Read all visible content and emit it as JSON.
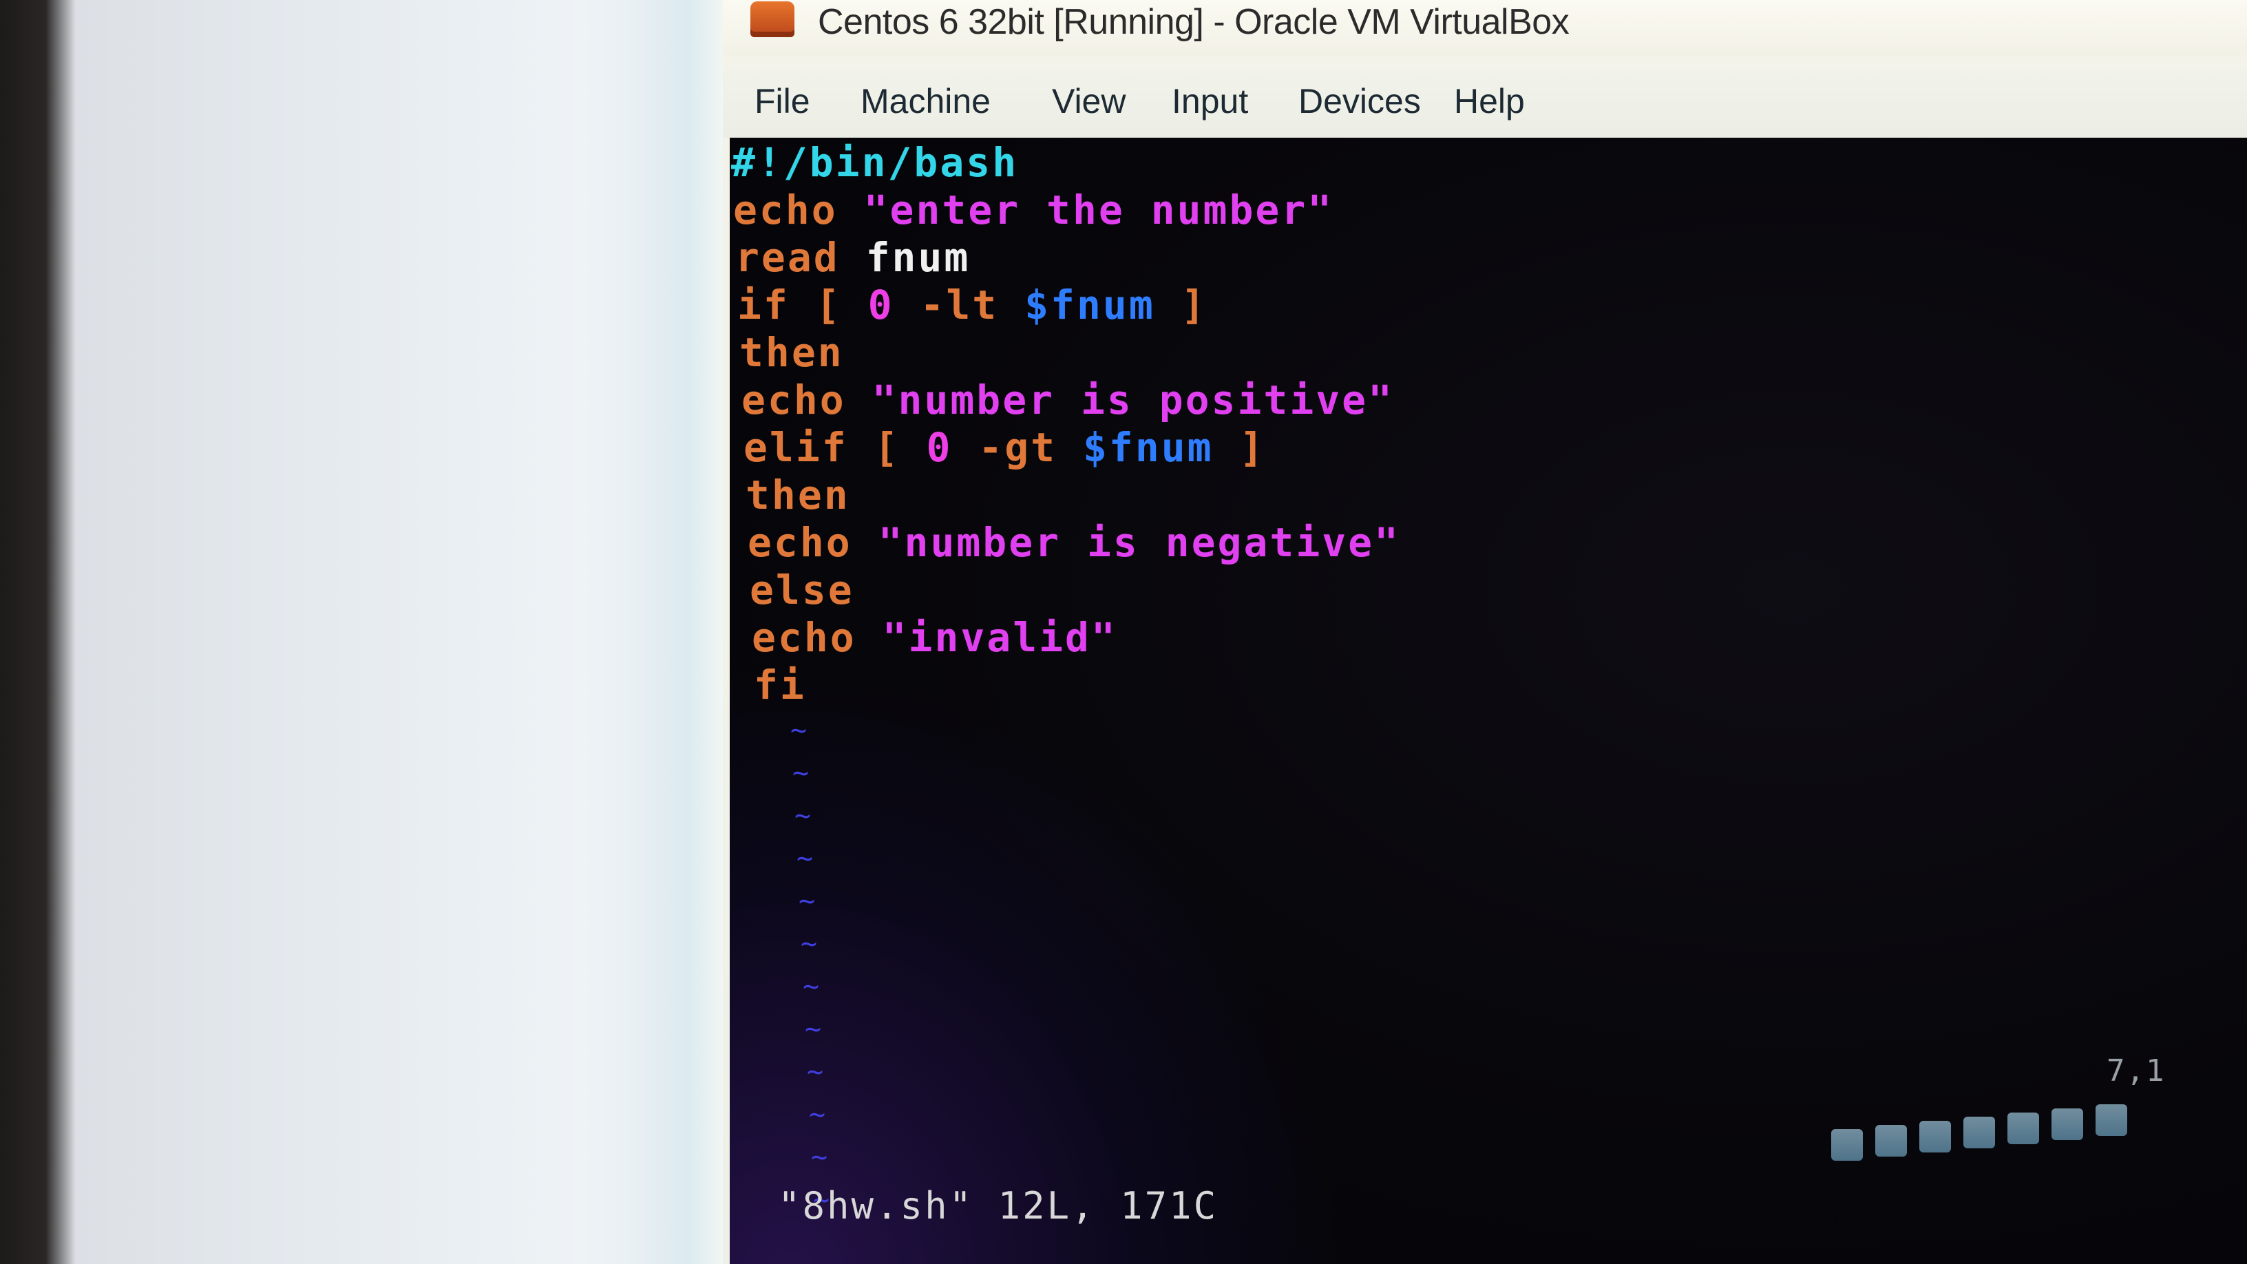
{
  "window": {
    "title": "Centos 6 32bit [Running] - Oracle VM VirtualBox",
    "icon": "virtualbox-app-icon"
  },
  "menu": {
    "items": [
      {
        "label": "File"
      },
      {
        "label": "Machine"
      },
      {
        "label": "View"
      },
      {
        "label": "Input"
      },
      {
        "label": "Devices"
      },
      {
        "label": "Help"
      }
    ]
  },
  "editor": {
    "lines": [
      [
        {
          "t": "#!/bin/bash",
          "k": "shebang"
        }
      ],
      [
        {
          "t": "echo ",
          "k": "kw"
        },
        {
          "t": "\"enter the number\"",
          "k": "str"
        }
      ],
      [
        {
          "t": "read ",
          "k": "kw"
        },
        {
          "t": "fnum",
          "k": "plain"
        }
      ],
      [
        {
          "t": "if ",
          "k": "kw"
        },
        {
          "t": "[ ",
          "k": "op"
        },
        {
          "t": "0",
          "k": "num"
        },
        {
          "t": " -lt ",
          "k": "op"
        },
        {
          "t": "$fnum",
          "k": "var"
        },
        {
          "t": " ]",
          "k": "op"
        }
      ],
      [
        {
          "t": "then",
          "k": "kw"
        }
      ],
      [
        {
          "t": "echo ",
          "k": "kw"
        },
        {
          "t": "\"number is positive\"",
          "k": "str"
        }
      ],
      [
        {
          "t": "elif ",
          "k": "kw"
        },
        {
          "t": "[ ",
          "k": "op"
        },
        {
          "t": "0",
          "k": "num"
        },
        {
          "t": " -gt ",
          "k": "op"
        },
        {
          "t": "$fnum",
          "k": "var"
        },
        {
          "t": " ]",
          "k": "op"
        }
      ],
      [
        {
          "t": "then",
          "k": "kw"
        }
      ],
      [
        {
          "t": "echo ",
          "k": "kw"
        },
        {
          "t": "\"number is negative\"",
          "k": "str"
        }
      ],
      [
        {
          "t": "else",
          "k": "kw"
        }
      ],
      [
        {
          "t": "echo ",
          "k": "kw"
        },
        {
          "t": "\"invalid\"",
          "k": "str"
        }
      ],
      [
        {
          "t": "fi",
          "k": "kw"
        }
      ]
    ],
    "empty_line_marker": "~",
    "empty_lines": 12,
    "status_message": "\"8hw.sh\" 12L, 171C",
    "cursor_position": "7,1"
  },
  "status_bar": {
    "icons": [
      "hard-disk-icon",
      "optical-drive-icon",
      "network-icon",
      "usb-icon",
      "shared-folders-icon",
      "display-icon",
      "capture-icon"
    ]
  },
  "colors": {
    "keyword": "#e0783a",
    "string": "#e040f0",
    "number": "#ee3fe6",
    "variable": "#2f7dff",
    "shebang": "#33d6e8",
    "plain": "#f0f0f0",
    "tilde": "#3f3fe0"
  }
}
